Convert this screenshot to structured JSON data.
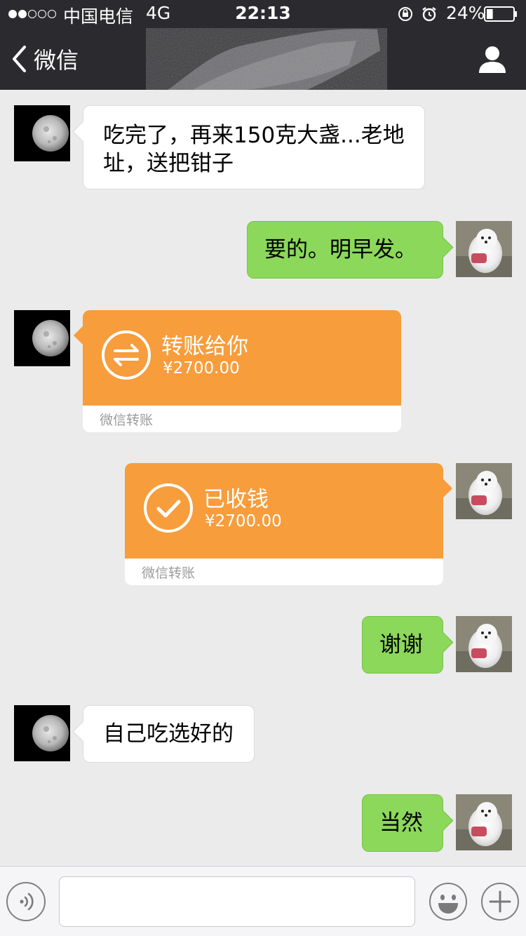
{
  "status_bar": {
    "signal_filled": 2,
    "signal_total": 5,
    "carrier": "中国电信",
    "network": "4G",
    "time": "22:13",
    "battery_pct": "24%",
    "battery_level": 0.24,
    "icons": [
      "rotation-lock-icon",
      "alarm-icon",
      "battery-icon"
    ]
  },
  "nav": {
    "back_label": "微信",
    "back_icon": "chevron-left-icon",
    "right_icon": "user-profile-icon"
  },
  "messages": [
    {
      "side": "in",
      "type": "text",
      "avatar": "moon-avatar",
      "text": "吃完了，再来150克大盏...老地址，送把钳子"
    },
    {
      "side": "out",
      "type": "text",
      "avatar": "puppy-avatar",
      "text": "要的。明早发。"
    },
    {
      "side": "in",
      "type": "transfer",
      "avatar": "moon-avatar",
      "icon": "transfer-arrows-icon",
      "title": "转账给你",
      "amount": "¥2700.00",
      "footer": "微信转账"
    },
    {
      "side": "out",
      "type": "transfer",
      "avatar": "puppy-avatar",
      "icon": "check-icon",
      "title": "已收钱",
      "amount": "¥2700.00",
      "footer": "微信转账"
    },
    {
      "side": "out",
      "type": "text",
      "avatar": "puppy-avatar",
      "text": "谢谢"
    },
    {
      "side": "in",
      "type": "text",
      "avatar": "moon-avatar",
      "text": "自己吃选好的"
    },
    {
      "side": "out",
      "type": "text",
      "avatar": "puppy-avatar",
      "text": "当然"
    }
  ],
  "input_bar": {
    "voice_icon": "voice-icon",
    "input_value": "",
    "emoji_icon": "emoji-icon",
    "plus_icon": "plus-icon"
  },
  "colors": {
    "nav_bg": "#2b2b2f",
    "chat_bg": "#ebebeb",
    "bubble_out": "#8bd85b",
    "bubble_in": "#ffffff",
    "transfer": "#f79d3c"
  }
}
